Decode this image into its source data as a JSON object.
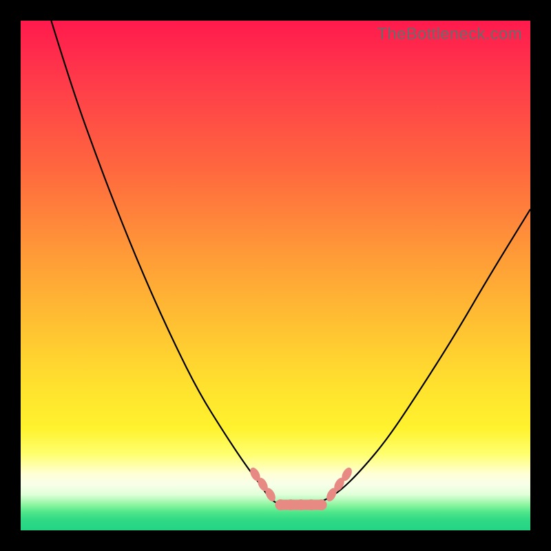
{
  "watermark": "TheBottleneck.com",
  "colors": {
    "frame": "#000000",
    "curve": "#000000",
    "marker": "#e88a84",
    "gradient_top": "#ff1a4d",
    "gradient_bottom": "#24d484"
  },
  "chart_data": {
    "type": "line",
    "title": "",
    "xlabel": "",
    "ylabel": "",
    "xlim": [
      0,
      100
    ],
    "ylim": [
      0,
      100
    ],
    "note": "Axes are unlabeled; values are percent-of-plot estimates. Curve is a V-shaped bottleneck profile with a flat minimum plateau. Lower y means closer to optimal (green).",
    "series": [
      {
        "name": "bottleneck-curve",
        "x": [
          6,
          10,
          15,
          20,
          25,
          30,
          35,
          40,
          44,
          47,
          49,
          51,
          54,
          57,
          60,
          63,
          67,
          72,
          78,
          85,
          92,
          100
        ],
        "y": [
          100,
          87,
          73,
          60,
          48,
          37,
          27,
          19,
          13,
          9,
          6,
          5,
          5,
          5,
          6,
          8,
          12,
          18,
          27,
          38,
          50,
          63
        ]
      }
    ],
    "markers": {
      "left_arm": [
        {
          "x": 46,
          "y": 11
        },
        {
          "x": 47.5,
          "y": 9
        },
        {
          "x": 49,
          "y": 7
        }
      ],
      "right_arm": [
        {
          "x": 61,
          "y": 7
        },
        {
          "x": 62.5,
          "y": 9
        },
        {
          "x": 64,
          "y": 11
        }
      ],
      "plateau": [
        {
          "x": 51,
          "y": 5
        },
        {
          "x": 53,
          "y": 5
        },
        {
          "x": 55,
          "y": 5
        },
        {
          "x": 57,
          "y": 5
        },
        {
          "x": 59,
          "y": 5
        }
      ]
    }
  }
}
